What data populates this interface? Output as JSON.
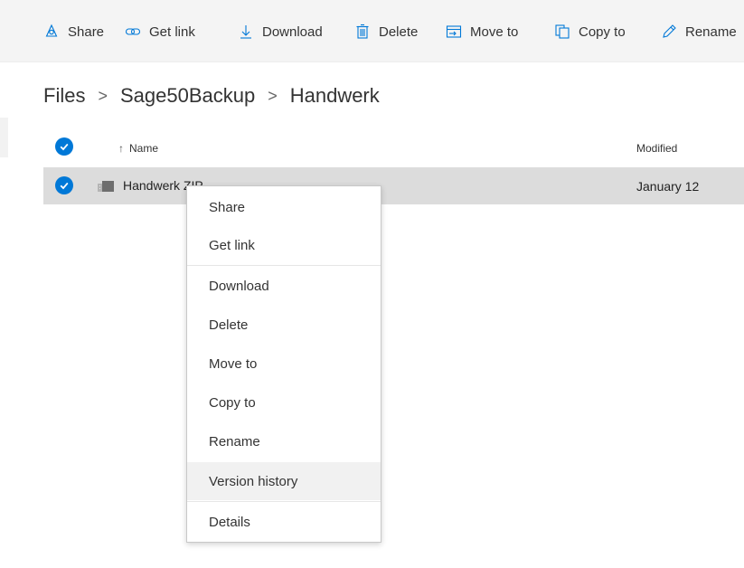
{
  "commandbar": {
    "items": [
      {
        "label": "Share",
        "icon": "share-icon"
      },
      {
        "label": "Get link",
        "icon": "link-icon"
      },
      {
        "label": "Download",
        "icon": "download-icon"
      },
      {
        "label": "Delete",
        "icon": "trash-icon"
      },
      {
        "label": "Move to",
        "icon": "move-icon"
      },
      {
        "label": "Copy to",
        "icon": "copy-icon"
      },
      {
        "label": "Rename",
        "icon": "pencil-icon"
      }
    ]
  },
  "breadcrumb": {
    "items": [
      "Files",
      "Sage50Backup",
      "Handwerk"
    ],
    "separator": ">"
  },
  "list": {
    "headers": {
      "sort_arrow": "↑",
      "name": "Name",
      "modified": "Modified"
    },
    "rows": [
      {
        "name": "Handwerk.ZIP",
        "visible_name": "Handwerk ZIP",
        "modified": "January 12",
        "selected": true
      }
    ]
  },
  "context_menu": {
    "items": [
      {
        "label": "Share"
      },
      {
        "label": "Get link"
      },
      {
        "label": "Download"
      },
      {
        "label": "Delete"
      },
      {
        "label": "Move to"
      },
      {
        "label": "Copy to"
      },
      {
        "label": "Rename"
      },
      {
        "label": "Version history",
        "highlighted": true
      },
      {
        "label": "Details"
      }
    ]
  },
  "colors": {
    "accent": "#0078d7",
    "selected_row": "#dcdcdc",
    "commandbar_bg": "#f4f4f4",
    "menu_hover": "#f1f1f1"
  }
}
